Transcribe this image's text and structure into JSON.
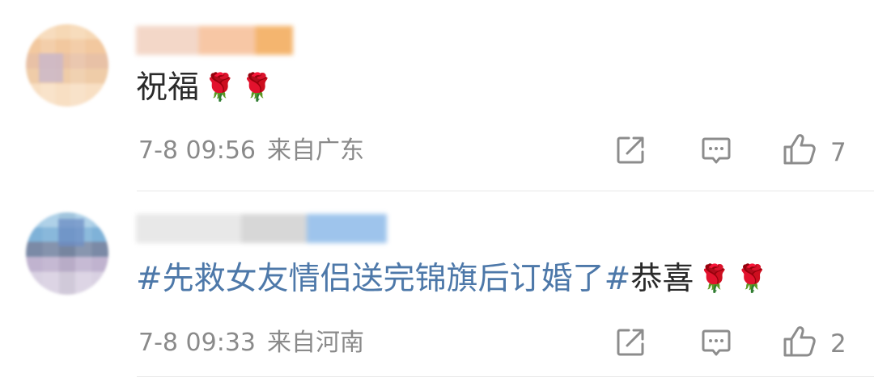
{
  "comments": [
    {
      "text": "祝福",
      "roses": [
        "🌹",
        "🌹"
      ],
      "time": "7-8 09:56",
      "location": "来自广东",
      "like_count": "7"
    },
    {
      "hashtag": "#先救女友情侣送完锦旗后订婚了#",
      "text": "恭喜",
      "roses": [
        "🌹",
        "🌹"
      ],
      "time": "7-8 09:33",
      "location": "来自河南",
      "like_count": "2"
    }
  ],
  "icons": {
    "share": "share-icon",
    "comment": "comment-icon",
    "like": "like-icon"
  },
  "colors": {
    "hashtag": "#4d78a9",
    "meta_text": "#8a8a8a",
    "icon": "#8c8c8c",
    "divider": "#e8e8e8"
  }
}
